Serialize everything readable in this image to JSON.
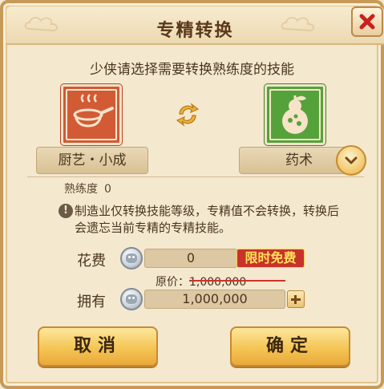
{
  "dialog": {
    "title": "专精转换",
    "instruction": "少侠请选择需要转换熟练度的技能"
  },
  "source_skill": {
    "label": "厨艺・小成",
    "icon": "cooking-pan-icon",
    "color": "#d25a35"
  },
  "target_skill": {
    "label": "药术",
    "icon": "medicine-gourd-icon",
    "color": "#55a23a"
  },
  "proficiency": {
    "label": "熟练度",
    "value": "0"
  },
  "notice": {
    "icon": "exclamation-icon",
    "text": "制造业仅转换技能等级，专精值不会转换，转换后会遗忘当前专精的专精技能。"
  },
  "cost": {
    "label": "花费",
    "value": "0",
    "badge": "限时免费",
    "original_label": "原价：",
    "original_value": "1,000,000"
  },
  "owned": {
    "label": "拥有",
    "value": "1,000,000"
  },
  "buttons": {
    "cancel": "取消",
    "confirm": "确定"
  }
}
